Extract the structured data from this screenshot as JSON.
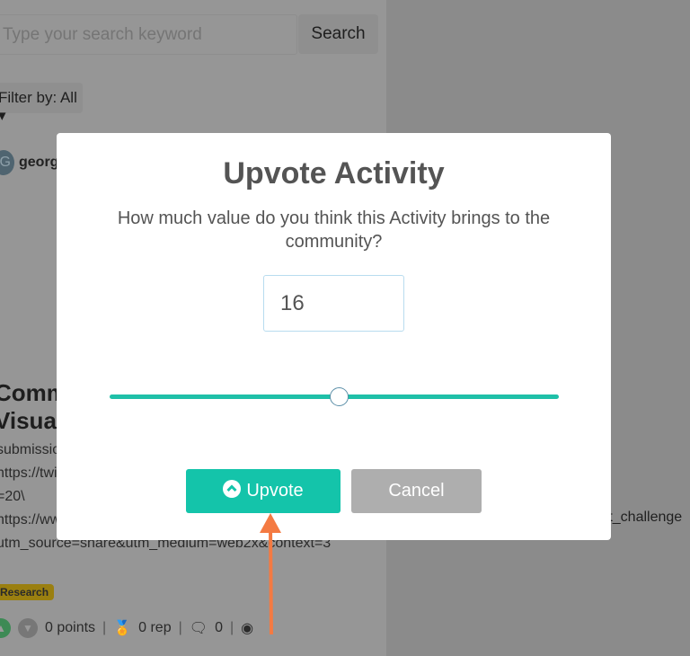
{
  "background": {
    "search": {
      "placeholder": "Type your search keyword",
      "button": "Search"
    },
    "filter": "Filter by: All ▾",
    "post": {
      "avatar_letter": "G",
      "username": "georg",
      "title_lines": "Commu\nVisual/",
      "body": "submissio\nhttps://twi\n=20\\\nhttps://ww\nutm_source=share&utm_medium=web2x&context=3",
      "tag": "Research",
      "points": "0 points",
      "rep": "0 rep",
      "comments": "0"
    },
    "right_text": "rt_challenge"
  },
  "modal": {
    "title": "Upvote Activity",
    "subtitle": "How much value do you think this Activity brings to the community?",
    "value": "16",
    "slider_percent": 51,
    "upvote_label": "Upvote",
    "cancel_label": "Cancel",
    "colors": {
      "accent": "#14c4aa",
      "cancel": "#aeaeae",
      "annotation_arrow": "#f47a42"
    }
  }
}
